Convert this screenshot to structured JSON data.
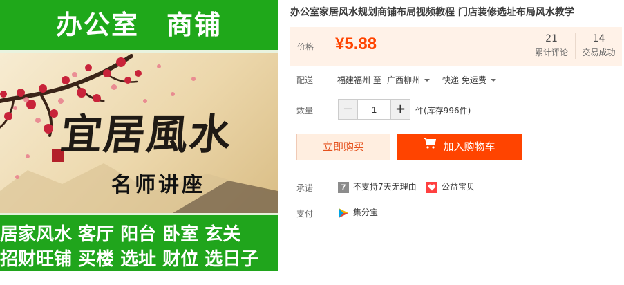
{
  "product_image": {
    "banner_top": "办公室　商铺",
    "calligraphy": "宜居風水",
    "lecture": "名师讲座",
    "banner_line_1": "居家风水 客厅 阳台 卧室 玄关",
    "banner_line_2": "招财旺铺 买楼 选址 财位 选日子",
    "colors": {
      "banner_green": "#1fa81a",
      "art_background": "#f4e6c6",
      "blossom": "#c8233a"
    }
  },
  "title": "办公室家居风水规划商铺布局视频教程 门店装修选址布局风水教学",
  "price": {
    "label": "价格",
    "value": "¥5.88",
    "color": "#ff4400",
    "reviews_count": "21",
    "reviews_label": "累计评论",
    "deals_count": "14",
    "deals_label": "交易成功"
  },
  "shipping": {
    "label": "配送",
    "from": "福建福州 至",
    "to": "广西柳州",
    "method": "快递 免运费"
  },
  "quantity": {
    "label": "数量",
    "minus": "−",
    "value": "1",
    "plus": "+",
    "stock": "件(库存996件)"
  },
  "actions": {
    "buy_now": "立即购买",
    "add_to_cart": "加入购物车",
    "cart_icon": "cart-icon"
  },
  "promise": {
    "label": "承诺",
    "item1_icon_text": "7",
    "item1": "不支持7天无理由",
    "item2": "公益宝贝"
  },
  "payment": {
    "label": "支付",
    "method": "集分宝"
  }
}
